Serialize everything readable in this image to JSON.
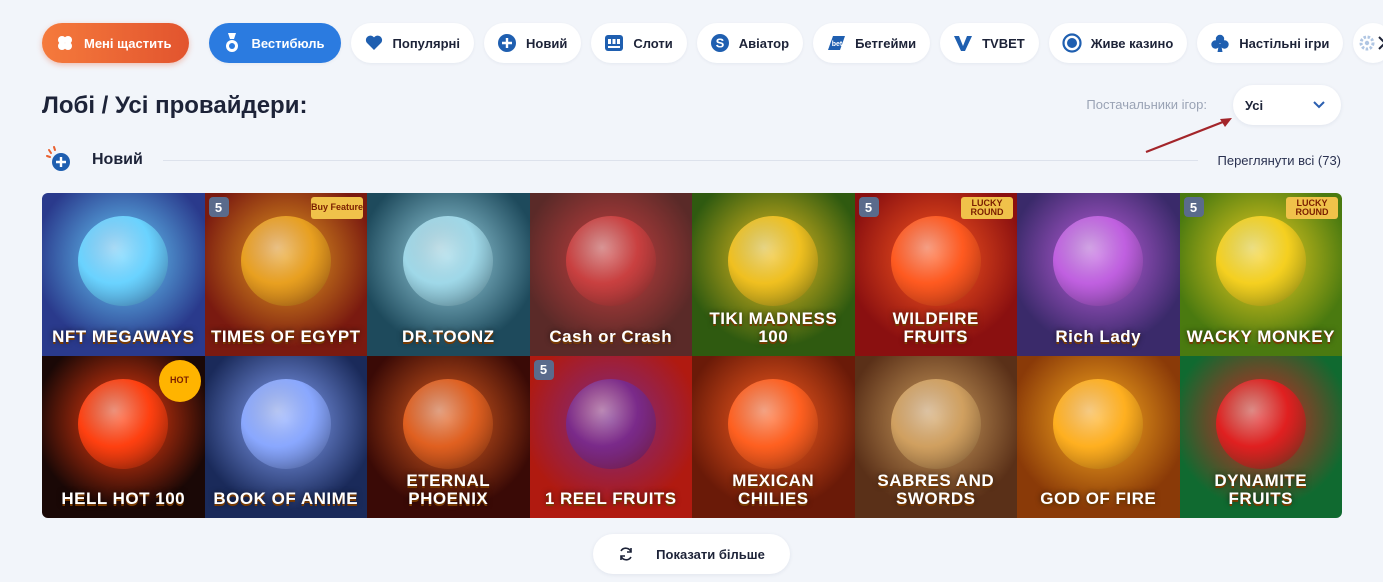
{
  "nav": {
    "items": [
      {
        "label": "Мені щастить",
        "icon": "clover-icon",
        "style": "orange"
      },
      {
        "label": "Вестибюль",
        "icon": "medal-icon",
        "style": "blue"
      },
      {
        "label": "Популярні",
        "icon": "heart-icon"
      },
      {
        "label": "Новий",
        "icon": "plus-circle-icon"
      },
      {
        "label": "Слоти",
        "icon": "slot-machine-icon"
      },
      {
        "label": "Авіатор",
        "icon": "aviator-icon"
      },
      {
        "label": "Бетгейми",
        "icon": "betgames-icon"
      },
      {
        "label": "TVBET",
        "icon": "tvbet-icon"
      },
      {
        "label": "Живе казино",
        "icon": "live-dot-icon"
      },
      {
        "label": "Настільні ігри",
        "icon": "club-suit-icon"
      }
    ]
  },
  "page": {
    "title": "Лобі / Усі провайдери:",
    "providers_label": "Постачальники ігор:",
    "providers_value": "Усі"
  },
  "section": {
    "title": "Новий",
    "view_all": "Переглянути всі (73)"
  },
  "games": [
    {
      "name": "NFT MEGAWAYS",
      "bg": "#2a3a8c",
      "accent": "#6ad3ff"
    },
    {
      "name": "TIMES OF EGYPT",
      "bg": "#7a1a10",
      "accent": "#e8a020",
      "badge": "5",
      "corner": "Buy Feature"
    },
    {
      "name": "DR.TOONZ",
      "bg": "#1e4a5c",
      "accent": "#9fd8e8"
    },
    {
      "name": "Cash or Crash",
      "bg": "#5a2a28",
      "accent": "#c94040"
    },
    {
      "name": "TIKI MADNESS 100",
      "bg": "#2f5a10",
      "accent": "#f0c020"
    },
    {
      "name": "WILDFIRE FRUITS",
      "bg": "#8a1010",
      "accent": "#ff5a20",
      "badge": "5",
      "corner": "LUCKY ROUND"
    },
    {
      "name": "Rich Lady",
      "bg": "#3a2a6a",
      "accent": "#c060e0"
    },
    {
      "name": "WACKY MONKEY",
      "bg": "#4a7a10",
      "accent": "#f5d020",
      "badge": "5",
      "corner": "LUCKY ROUND"
    },
    {
      "name": "HELL HOT 100",
      "bg": "#1a0806",
      "accent": "#ff4010",
      "corner": "HOT"
    },
    {
      "name": "BOOK OF ANIME",
      "bg": "#1a2a5a",
      "accent": "#8aa8ff"
    },
    {
      "name": "ETERNAL PHOENIX",
      "bg": "#3a0a06",
      "accent": "#e06020"
    },
    {
      "name": "1 REEL FRUITS",
      "bg": "#b01a10",
      "accent": "#7a2a8a",
      "badge": "5"
    },
    {
      "name": "MEXICAN CHILIES",
      "bg": "#6a1a08",
      "accent": "#ff6020"
    },
    {
      "name": "SABRES AND SWORDS",
      "bg": "#5a3018",
      "accent": "#d0a060"
    },
    {
      "name": "GOD OF FIRE",
      "bg": "#8a3a08",
      "accent": "#ffb020"
    },
    {
      "name": "DYNAMITE FRUITS",
      "bg": "#106a30",
      "accent": "#e02020"
    }
  ],
  "load_more": {
    "label": "Показати більше",
    "icon": "refresh-icon"
  },
  "colors": {
    "accent_blue": "#2b7be0",
    "accent_orange": "#e9602f",
    "text": "#1d2338",
    "arrow": "#a3252a"
  }
}
